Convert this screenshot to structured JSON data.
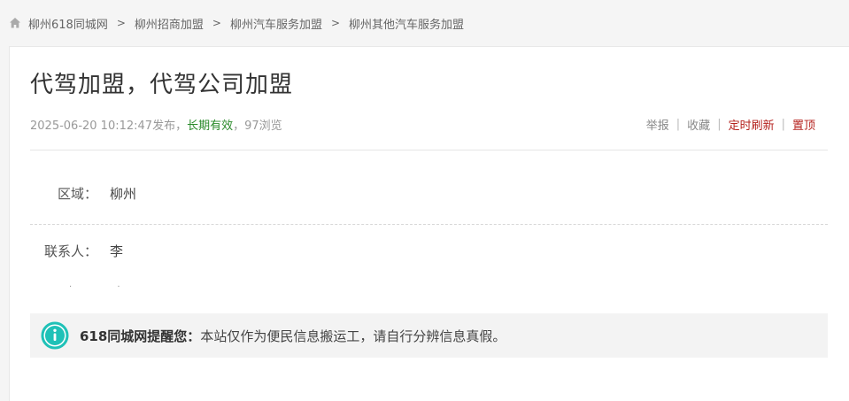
{
  "breadcrumb": {
    "items": [
      "柳州618同城网",
      "柳州招商加盟",
      "柳州汽车服务加盟",
      "柳州其他汽车服务加盟"
    ],
    "separator": ">"
  },
  "post": {
    "title": "代驾加盟，代驾公司加盟",
    "published": "2025-06-20 10:12:47发布，",
    "validity": "长期有效",
    "views": "，97浏览"
  },
  "actions": {
    "report": "举报",
    "favorite": "收藏",
    "scheduled_refresh": "定时刷新",
    "pin": "置顶"
  },
  "fields": {
    "region_label": "区域：",
    "region_value": "柳州",
    "contact_label": "联系人：",
    "contact_value": "李"
  },
  "notice": {
    "title": "618同城网提醒您：",
    "text": "本站仅作为便民信息搬运工，请自行分辨信息真假。"
  },
  "colors": {
    "accent_red": "#b5231f",
    "valid_green": "#2a8a2a",
    "notice_icon": "#1fc1b7"
  }
}
